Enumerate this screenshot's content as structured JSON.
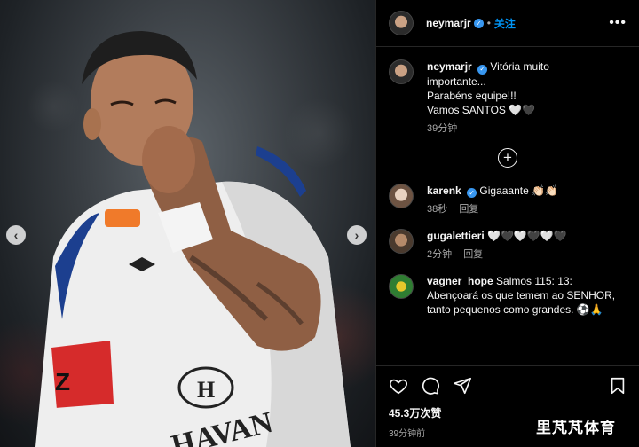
{
  "photo": {
    "shirt_sponsor_line1": "H",
    "shirt_sponsor_line2": "HAVAN",
    "prev_arrow": "‹",
    "next_arrow": "›"
  },
  "post": {
    "username": "neymarjr",
    "follow_label": "关注",
    "more_label": "•••",
    "caption": {
      "lines": [
        "Vitória muito",
        "importante...",
        "Parabéns equipe!!!",
        "Vamos SANTOS"
      ],
      "emoji": "🤍🖤",
      "time": "39分钟"
    },
    "load_more_label": "+",
    "comments": [
      {
        "user": "karenk",
        "verified": true,
        "text": "Gigaaante",
        "emoji": "👏🏻👏🏻",
        "time": "38秒",
        "reply": "回复"
      },
      {
        "user": "gugalettieri",
        "verified": false,
        "text": "",
        "emoji": "🤍🖤🤍🖤🤍🖤",
        "time": "2分钟",
        "reply": "回复"
      },
      {
        "user": "vagner_hope",
        "verified": false,
        "text": "Salmos 115: 13: Abençoará os que temem ao SENHOR, tanto pequenos como grandes.",
        "emoji": "⚽🙏",
        "time": "",
        "reply": ""
      }
    ],
    "likes": "45.3万次赞",
    "posted_time": "39分钟前"
  },
  "icons": {
    "like": "heart-icon",
    "comment": "comment-icon",
    "share": "share-icon",
    "save": "bookmark-icon"
  },
  "colors": {
    "accent": "#0095f6",
    "verified": "#3897f0",
    "background": "#000000",
    "shirt_stripe": "#1c3f8f",
    "armband": "#d62b2b"
  },
  "watermark": "里芃芃体育"
}
